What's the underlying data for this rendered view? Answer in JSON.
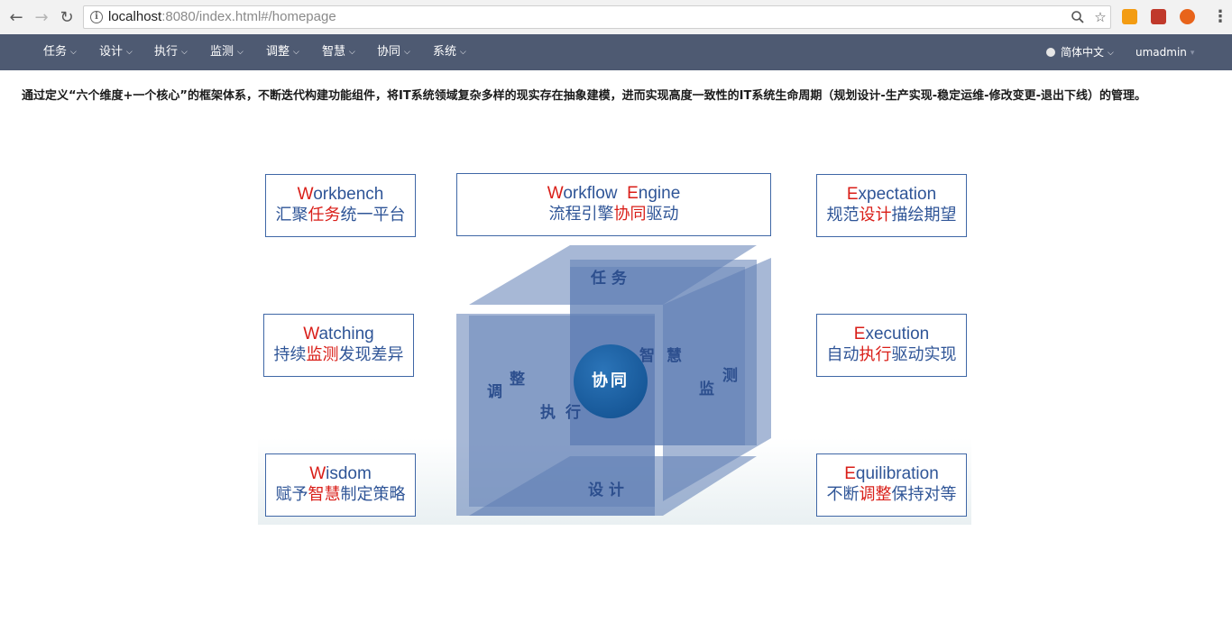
{
  "browser": {
    "url_host": "localhost",
    "url_rest": ":8080/index.html#/homepage"
  },
  "navbar": {
    "items": [
      {
        "label": "任务"
      },
      {
        "label": "设计"
      },
      {
        "label": "执行"
      },
      {
        "label": "监测"
      },
      {
        "label": "调整"
      },
      {
        "label": "智慧"
      },
      {
        "label": "协同"
      },
      {
        "label": "系统"
      }
    ],
    "language": "简体中文",
    "user": "umadmin"
  },
  "intro": {
    "text": "通过定义“六个维度+一个核心”的框架体系，不断迭代构建功能组件，将IT系统领域复杂多样的现实存在抽象建模，进而实现高度一致性的IT系统生命周期（规划设计-生产实现-稳定运维-修改变更-退出下线）的管理。"
  },
  "diagram": {
    "cards": {
      "workbench": {
        "en_first": "W",
        "en_rest": "orkbench",
        "cn_a": "汇聚",
        "cn_red": "任务",
        "cn_b": "统一平台"
      },
      "workflow": {
        "en_first": "W",
        "en_mid": "orkflow  ",
        "en_first2": "E",
        "en_rest": "ngine",
        "cn_a": "流程引擎",
        "cn_red": "协同",
        "cn_b": "驱动"
      },
      "expectation": {
        "en_first": "E",
        "en_rest": "xpectation",
        "cn_a": "规范",
        "cn_red": "设计",
        "cn_b": "描绘期望"
      },
      "watching": {
        "en_first": "W",
        "en_rest": "atching",
        "cn_a": "持续",
        "cn_red": "监测",
        "cn_b": "发现差异"
      },
      "execution": {
        "en_first": "E",
        "en_rest": "xecution",
        "cn_a": "自动",
        "cn_red": "执行",
        "cn_b": "驱动实现"
      },
      "wisdom": {
        "en_first": "W",
        "en_rest": "isdom",
        "cn_a": "赋予",
        "cn_red": "智慧",
        "cn_b": "制定策略"
      },
      "equilibration": {
        "en_first": "E",
        "en_rest": "quilibration",
        "cn_a": "不断",
        "cn_red": "调整",
        "cn_b": "保持对等"
      }
    },
    "cube": {
      "top": "任 务",
      "bottom": "设 计",
      "left_a": "调",
      "left_b": "整",
      "back_a": "智",
      "back_b": "慧",
      "right_a": "监",
      "right_b": "测",
      "front_a": "执",
      "front_b": "行",
      "core": "协同"
    }
  }
}
